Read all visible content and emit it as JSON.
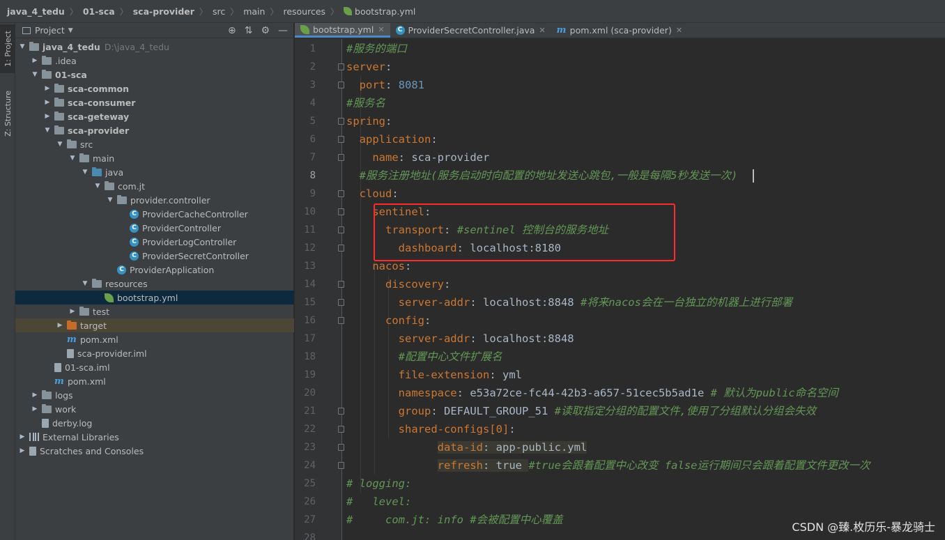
{
  "breadcrumb": [
    "java_4_tedu",
    "01-sca",
    "sca-provider",
    "src",
    "main",
    "resources",
    "bootstrap.yml"
  ],
  "side_strip": {
    "project_tab": "1: Project",
    "structure_tab": "Z: Structure"
  },
  "project_panel": {
    "title": "Project",
    "tree": [
      {
        "label": "java_4_tedu",
        "extra": "D:\\java_4_tedu",
        "icon": "module-folder-icon",
        "arrow": "open"
      },
      {
        "label": ".idea",
        "icon": "folder-icon",
        "arrow": "closed"
      },
      {
        "label": "01-sca",
        "icon": "module-folder-icon",
        "arrow": "open"
      },
      {
        "label": "sca-common",
        "icon": "module-folder-icon",
        "arrow": "closed"
      },
      {
        "label": "sca-consumer",
        "icon": "module-folder-icon",
        "arrow": "closed"
      },
      {
        "label": "sca-geteway",
        "icon": "module-folder-icon",
        "arrow": "closed"
      },
      {
        "label": "sca-provider",
        "icon": "module-folder-icon",
        "arrow": "open"
      },
      {
        "label": "src",
        "icon": "folder-icon",
        "arrow": "open"
      },
      {
        "label": "main",
        "icon": "folder-icon",
        "arrow": "open"
      },
      {
        "label": "java",
        "icon": "source-folder-icon",
        "arrow": "open"
      },
      {
        "label": "com.jt",
        "icon": "package-icon",
        "arrow": "open"
      },
      {
        "label": "provider.controller",
        "icon": "package-icon",
        "arrow": "open"
      },
      {
        "label": "ProviderCacheController",
        "icon": "class-icon",
        "arrow": ""
      },
      {
        "label": "ProviderController",
        "icon": "class-icon",
        "arrow": ""
      },
      {
        "label": "ProviderLogController",
        "icon": "class-icon",
        "arrow": ""
      },
      {
        "label": "ProviderSecretController",
        "icon": "class-icon",
        "arrow": ""
      },
      {
        "label": "ProviderApplication",
        "icon": "spring-class-icon",
        "arrow": ""
      },
      {
        "label": "resources",
        "icon": "resources-folder-icon",
        "arrow": "open"
      },
      {
        "label": "bootstrap.yml",
        "icon": "spring-yml-icon",
        "arrow": ""
      },
      {
        "label": "test",
        "icon": "folder-icon",
        "arrow": "closed"
      },
      {
        "label": "target",
        "icon": "excluded-folder-icon",
        "arrow": "closed"
      },
      {
        "label": "pom.xml",
        "icon": "maven-icon",
        "arrow": ""
      },
      {
        "label": "sca-provider.iml",
        "icon": "file-icon",
        "arrow": ""
      },
      {
        "label": "01-sca.iml",
        "icon": "file-icon",
        "arrow": ""
      },
      {
        "label": "pom.xml",
        "icon": "maven-icon",
        "arrow": ""
      },
      {
        "label": "logs",
        "icon": "folder-icon",
        "arrow": "closed"
      },
      {
        "label": "work",
        "icon": "folder-icon",
        "arrow": "closed"
      },
      {
        "label": "derby.log",
        "icon": "file-icon",
        "arrow": ""
      },
      {
        "label": "External Libraries",
        "icon": "library-icon",
        "arrow": "closed"
      },
      {
        "label": "Scratches and Consoles",
        "icon": "scratches-icon",
        "arrow": "closed"
      }
    ],
    "selected_index": 18
  },
  "tabs": [
    {
      "label": "bootstrap.yml",
      "icon": "spring-yml-icon",
      "active": true
    },
    {
      "label": "ProviderSecretController.java",
      "icon": "class-icon",
      "active": false
    },
    {
      "label": "pom.xml (sca-provider)",
      "icon": "maven-icon",
      "active": false
    }
  ],
  "editor": {
    "current_line": 8,
    "lines": [
      "#服务的端口",
      "server:",
      "  port: 8081",
      "#服务名",
      "spring:",
      "  application:",
      "    name: sca-provider",
      "  #服务注册地址(服务启动时向配置的地址发送心跳包,一般是每隔5秒发送一次)",
      "  cloud:",
      "    sentinel:",
      "      transport: #sentinel 控制台的服务地址",
      "        dashboard: localhost:8180",
      "    nacos:",
      "      discovery:",
      "        server-addr: localhost:8848 #将来nacos会在一台独立的机器上进行部署",
      "      config:",
      "        server-addr: localhost:8848",
      "        #配置中心文件扩展名",
      "        file-extension: yml",
      "        namespace: e53a72ce-fc44-42b3-a657-51cec5b5ad1e # 默认为public命名空间",
      "        group: DEFAULT_GROUP_51 #读取指定分组的配置文件,使用了分组默认分组会失效",
      "        shared-configs[0]:",
      "              data-id: app-public.yml",
      "              refresh: true #true会跟着配置中心改变 false运行期间只会跟着配置文件更改一次",
      "# logging:",
      "#   level:",
      "#     com.jt: info #会被配置中心覆盖",
      ""
    ]
  },
  "watermark": "CSDN @臻.枚历乐-暴龙骑士",
  "colors": {
    "key": "#cc7832",
    "comment": "#629755",
    "number": "#6897bb",
    "text": "#a9b7c6",
    "highlight_box": "#ff2a2a"
  }
}
